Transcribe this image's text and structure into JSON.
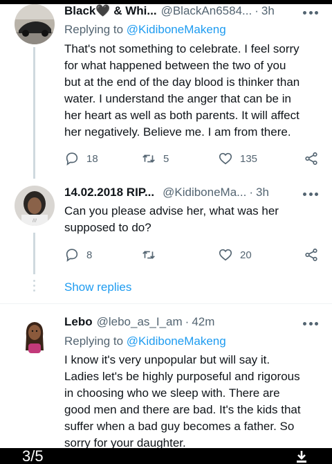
{
  "tweets": [
    {
      "name": "Black🖤 & Whi...",
      "handle": "@BlackAn6584...",
      "time": "3h",
      "reply_prefix": "Replying to",
      "reply_to": "@KidiboneMakeng",
      "lines": [
        "That's not something to celebrate. I feel sorry",
        "for what happened between the two of you",
        "but at the end of the day blood is thinker than",
        "water. I understand the anger that can be in",
        "her heart as well as both parents. It will affect",
        "her negatively. Believe me. I am from there."
      ],
      "replies": "18",
      "retweets": "5",
      "likes": "135"
    },
    {
      "name": "14.02.2018 RIP...",
      "handle": "@KidiboneMa...",
      "time": "3h",
      "lines": [
        "Can you please advise her, what was her",
        "supposed to do?"
      ],
      "replies": "8",
      "retweets": "",
      "likes": "20"
    },
    {
      "name": "Lebo",
      "handle": "@lebo_as_I_am",
      "time": "42m",
      "reply_prefix": "Replying to",
      "reply_to": "@KidiboneMakeng",
      "lines": [
        "I know it's very unpopular but will say it.",
        "Ladies let's be highly purposeful and rigorous",
        "in choosing who we sleep with. There are",
        "good men and there are bad. It's the kids that",
        "suffer when a bad guy becomes a father. So",
        "sorry for your daughter."
      ]
    }
  ],
  "show_replies": "Show replies",
  "page_counter": "3/5",
  "icons": {
    "reply": "reply-icon",
    "retweet": "retweet-icon",
    "like": "heart-icon",
    "share": "share-icon",
    "more": "more-icon",
    "download": "download-icon"
  },
  "colors": {
    "accent": "#1d9bf0",
    "secondary_text": "#536471",
    "primary_text": "#0f1419"
  }
}
